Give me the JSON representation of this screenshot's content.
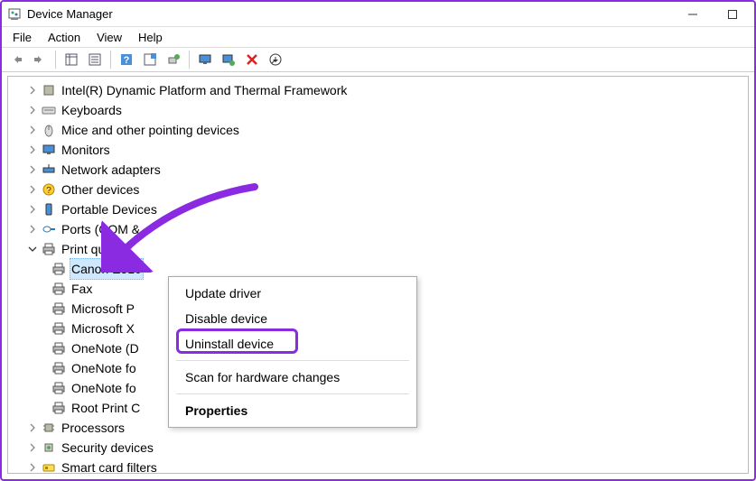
{
  "window": {
    "title": "Device Manager"
  },
  "menubar": {
    "file": "File",
    "action": "Action",
    "view": "View",
    "help": "Help"
  },
  "tree": {
    "intel": "Intel(R) Dynamic Platform and Thermal Framework",
    "keyboards": "Keyboards",
    "mice": "Mice and other pointing devices",
    "monitors": "Monitors",
    "network": "Network adapters",
    "other": "Other devices",
    "portable": "Portable Devices",
    "ports": "Ports (COM & ",
    "printq": "Print queues",
    "processors": "Processors",
    "security": "Security devices",
    "smartcard": "Smart card filters",
    "pq": {
      "canon": "Canon E510",
      "fax": "Fax",
      "msp": "Microsoft P",
      "msx": "Microsoft X",
      "onenoted": "OneNote (D",
      "onenotef1": "OneNote fo",
      "onenotef2": "OneNote fo",
      "rootpc": "Root Print C"
    }
  },
  "context": {
    "update": "Update driver",
    "disable": "Disable device",
    "uninstall": "Uninstall device",
    "scan": "Scan for hardware changes",
    "props": "Properties"
  }
}
